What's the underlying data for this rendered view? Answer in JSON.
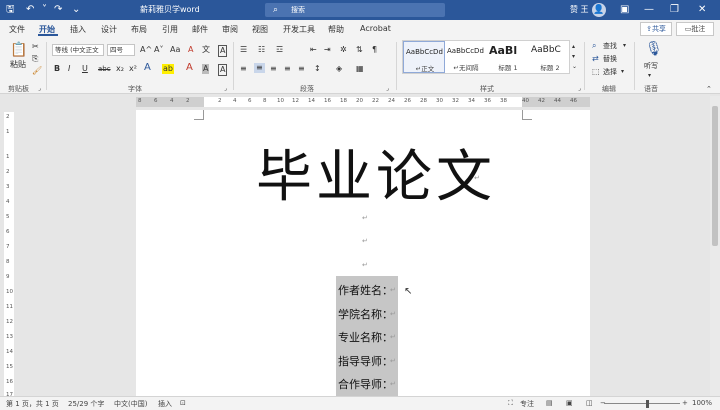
{
  "title_bar": {
    "autosave_icon": "save-icon",
    "doc_title": "薪莉雅贝学word",
    "search_placeholder": "搜索",
    "user_name": "赞 王",
    "avatar_initial": "👤",
    "minimize": "—",
    "restore": "❐",
    "close": "✕",
    "ribbon_options": "▣"
  },
  "menu": {
    "tabs": [
      "文件",
      "开始",
      "插入",
      "设计",
      "布局",
      "引用",
      "邮件",
      "审阅",
      "视图",
      "开发工具",
      "帮助",
      "Acrobat"
    ],
    "active_tab": "开始",
    "share_label": "共享",
    "comment_label": "批注"
  },
  "ribbon": {
    "clipboard": {
      "paste_label": "粘贴",
      "group_label": "剪贴板"
    },
    "font": {
      "font_name": "等线 (中文正文",
      "font_size": "四号",
      "grow": "A^",
      "shrink": "A˅",
      "case": "Aa",
      "clear": "A",
      "phonetic": "文",
      "border": "A",
      "bold": "B",
      "italic": "I",
      "underline": "U",
      "strike": "abc",
      "subscript": "x₂",
      "superscript": "x²",
      "effects": "A",
      "highlight": "ab",
      "font_color": "A",
      "char_shade": "A",
      "char_border": "A",
      "group_label": "字体"
    },
    "paragraph": {
      "group_label": "段落",
      "show_marks": "¶"
    },
    "styles": {
      "items": [
        {
          "sample": "AaBbCcDd",
          "name": "正文"
        },
        {
          "sample": "AaBbCcDd",
          "name": "无间隔"
        },
        {
          "sample": "AaBl",
          "name": "标题 1"
        },
        {
          "sample": "AaBbC",
          "name": "标题 2"
        }
      ],
      "group_label": "样式"
    },
    "editing": {
      "find": "查找",
      "replace": "替换",
      "select": "选择",
      "group_label": "编辑"
    },
    "voice": {
      "dictate": "听写",
      "group_label": "语音"
    }
  },
  "ruler": {
    "labels": [
      "8",
      "6",
      "4",
      "2",
      "2",
      "4",
      "6",
      "8",
      "10",
      "12",
      "14",
      "16",
      "18",
      "20",
      "22",
      "24",
      "26",
      "28",
      "30",
      "32",
      "34",
      "36",
      "38",
      "40",
      "42",
      "44",
      "46",
      "48"
    ],
    "vlabels": [
      "2",
      "1",
      "1",
      "2",
      "3",
      "4",
      "5",
      "6",
      "7",
      "8",
      "9",
      "10",
      "11",
      "12",
      "13",
      "14",
      "15",
      "16",
      "17"
    ]
  },
  "document": {
    "heading": "毕业论文",
    "para_mark": "↵",
    "fields": [
      "作者姓名：",
      "学院名称：",
      "专业名称：",
      "指导导师：",
      "合作导师："
    ]
  },
  "status_bar": {
    "page": "第 1 页，共 1 页",
    "words": "25/29 个字",
    "language": "中文(中国)",
    "insert_mode": "插入",
    "focus": "专注",
    "zoom": "100%"
  },
  "colors": {
    "accent": "#2b579a",
    "selection": "#c6c6c6"
  }
}
